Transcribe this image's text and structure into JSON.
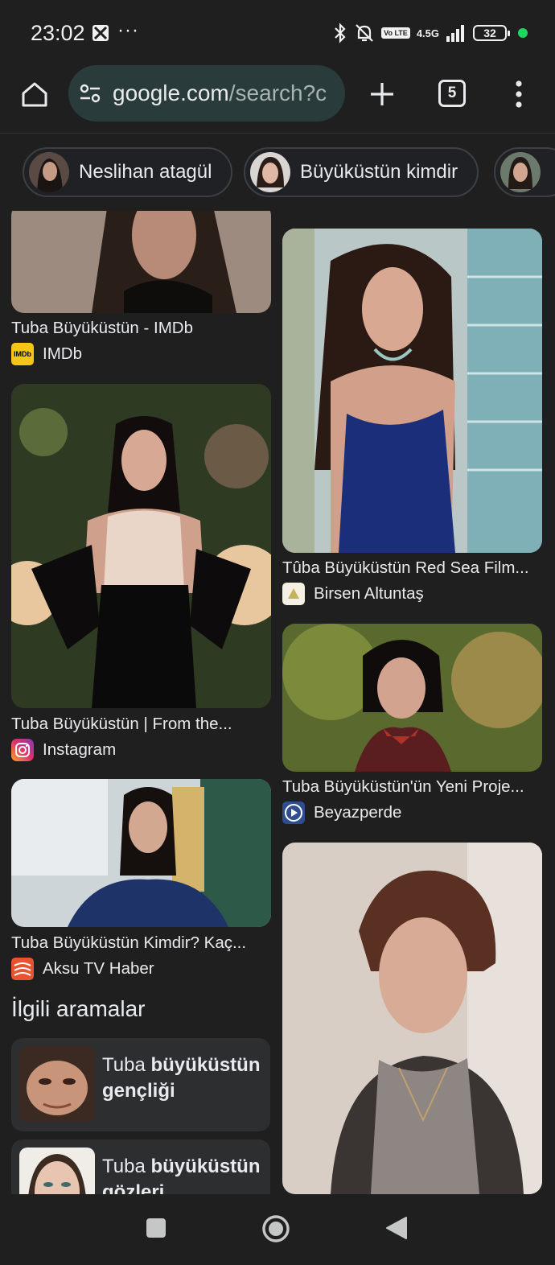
{
  "status_bar": {
    "time": "23:02",
    "more_dots": "···",
    "network": "4.5G",
    "volte": "Vo LTE",
    "battery": "32"
  },
  "toolbar": {
    "url_host": "google.com",
    "url_path": "/search?c",
    "tab_count": "5"
  },
  "chips": [
    {
      "label": "Neslihan atagül"
    },
    {
      "label": "Büyüküstün kimdir"
    },
    {
      "label": ""
    }
  ],
  "results": {
    "left": [
      {
        "title": "Tuba Büyüküstün - IMDb",
        "source": "IMDb",
        "source_icon": "imdb-icon",
        "icon_label": "IMDb"
      },
      {
        "title": "Tuba Büyüküstün | From the...",
        "source": "Instagram",
        "source_icon": "instagram-icon"
      },
      {
        "title": "Tuba Büyüküstün Kimdir? Kaç...",
        "source": "Aksu TV Haber",
        "source_icon": "aksu-tv-icon"
      }
    ],
    "right": [
      {
        "title": "Tûba Büyüküstün Red Sea Film...",
        "source": "Birsen Altuntaş",
        "source_icon": "birsen-altuntas-icon"
      },
      {
        "title": "Tuba Büyüküstün'ün Yeni Proje...",
        "source": "Beyazperde",
        "source_icon": "beyazperde-icon"
      }
    ]
  },
  "related": {
    "heading": "İlgili aramalar",
    "items": [
      {
        "prefix": "Tuba ",
        "bold": "büyüküstün gençliği"
      },
      {
        "prefix": "Tuba ",
        "bold": "büyüküstün gözleri"
      }
    ]
  },
  "colors": {
    "background": "#1f1f1f",
    "omnibox": "#2a3b3b",
    "chip_border": "#3c4043",
    "related_card": "#2d2e30",
    "status_green": "#1ed760"
  }
}
